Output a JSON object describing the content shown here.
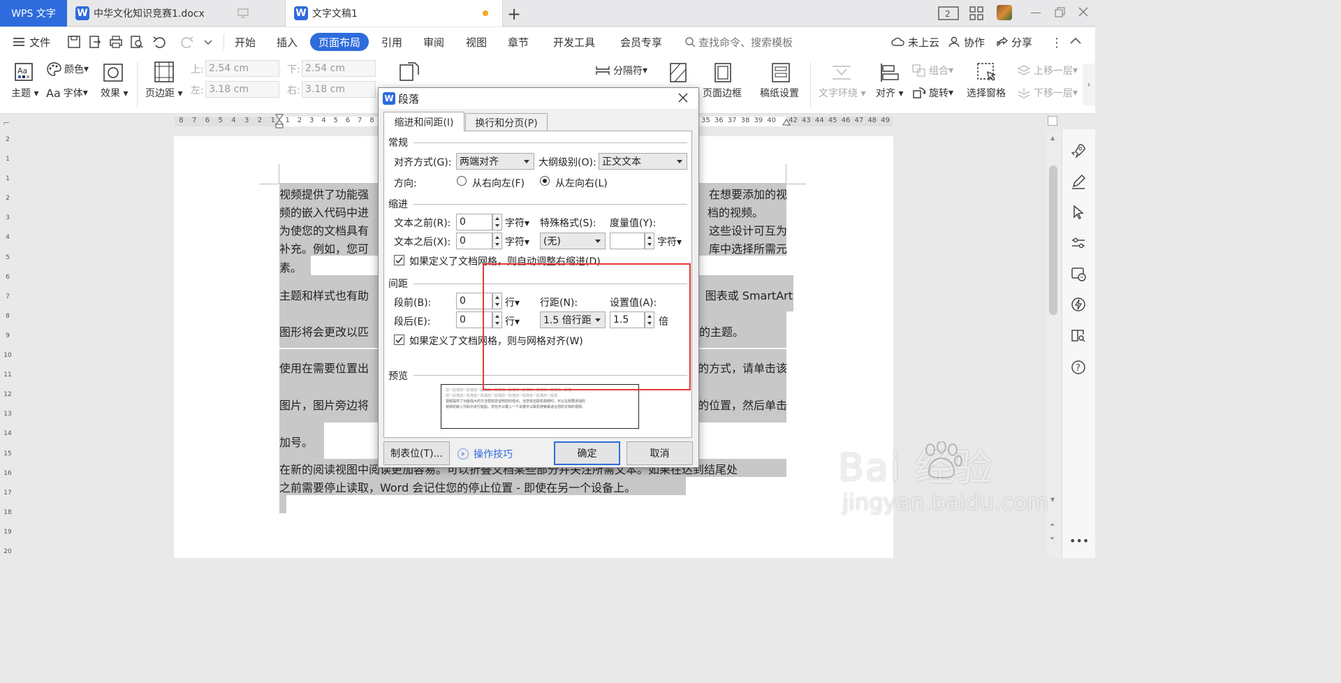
{
  "tabs": {
    "app": "WPS 文字",
    "doc1": "中华文化知识竞赛1.docx",
    "doc2": "文字文稿1"
  },
  "menubar": {
    "file": "文件",
    "items": [
      "开始",
      "插入",
      "页面布局",
      "引用",
      "审阅",
      "视图",
      "章节",
      "开发工具",
      "会员专享"
    ],
    "active": "页面布局",
    "search": "查找命令、搜索模板",
    "cloud": "未上云",
    "collab": "协作",
    "share": "分享"
  },
  "ribbon": {
    "theme": "主题",
    "colors": "颜色",
    "font": "字体",
    "effects": "效果",
    "margins": "页边距",
    "top_label": "上:",
    "top_value": "2.54 cm",
    "bottom_label": "下:",
    "bottom_value": "2.54 cm",
    "left_label": "左:",
    "left_value": "3.18 cm",
    "right_label": "右:",
    "right_value": "3.18 cm",
    "separator": "分隔符",
    "page_border": "页面边框",
    "grid_paper": "稿纸设置",
    "wrap": "文字环绕",
    "align": "对齐",
    "group": "组合",
    "rotate": "旋转",
    "select_pane": "选择窗格",
    "bring_forward": "上移一层",
    "send_backward": "下移一层"
  },
  "ruler": {
    "left_numbers": [
      "8",
      "7",
      "6",
      "5",
      "4",
      "3",
      "2",
      "1"
    ],
    "mid_numbers": [
      "1",
      "2",
      "3",
      "4",
      "5",
      "6",
      "7",
      "8"
    ],
    "right_numbers": [
      "35",
      "36",
      "37",
      "38",
      "39",
      "40",
      "42",
      "43",
      "44",
      "45",
      "46",
      "47",
      "48",
      "49"
    ],
    "v_numbers": [
      "2",
      "1",
      "1",
      "2",
      "3",
      "4",
      "5",
      "6",
      "7",
      "8",
      "9",
      "10",
      "11",
      "12",
      "13",
      "14",
      "15",
      "16",
      "17",
      "18",
      "19",
      "20"
    ]
  },
  "document": {
    "lines_left": [
      "视频提供了功能强",
      "频的嵌入代码中进",
      "为使您的文档具有",
      "补充。例如，您可",
      "素。",
      "主题和样式也有助",
      "图形将会更改以匹",
      "使用在需要位置出",
      "图片，图片旁边将",
      "加号。"
    ],
    "lines_right": [
      "在想要添加的视",
      "档的视频。",
      "这些设计可互为",
      "库中选择所需元",
      "",
      "图表或 SmartArt",
      "的主题。",
      "的方式，请单击该",
      "的位置，然后单击",
      ""
    ],
    "last_line1": "在新的阅读视图中阅读更加容易。可以折叠文档某些部分并关注所需文本。如果在达到结尾处",
    "last_line2": "之前需要停止读取，Word 会记住您的停止位置 - 即使在另一个设备上。"
  },
  "dialog": {
    "title": "段落",
    "tab_active": "缩进和间距(I)",
    "tab_other": "换行和分页(P)",
    "general": "常规",
    "align_label": "对齐方式(G):",
    "align_value": "两端对齐",
    "outline_label": "大纲级别(O):",
    "outline_value": "正文文本",
    "direction_label": "方向:",
    "rtl": "从右向左(F)",
    "ltr": "从左向右(L)",
    "indent": "缩进",
    "before_text_label": "文本之前(R):",
    "before_text_value": "0",
    "after_text_label": "文本之后(X):",
    "after_text_value": "0",
    "unit_char": "字符",
    "special_label": "特殊格式(S):",
    "special_value": "(无)",
    "measure_label": "度量值(Y):",
    "measure_value": "",
    "auto_indent": "如果定义了文档网格，则自动调整右缩进(D)",
    "spacing": "间距",
    "before_label": "段前(B):",
    "before_value": "0",
    "after_label": "段后(E):",
    "after_value": "0",
    "unit_line": "行",
    "line_spacing_label": "行距(N):",
    "line_spacing_value": "1.5 倍行距",
    "set_value_label": "设置值(A):",
    "set_value": "1.5",
    "unit_times": "倍",
    "snap_grid": "如果定义了文档网格，则与网格对齐(W)",
    "preview": "预览",
    "preview_line1": "前一段落前一段落前一段落前一段落前一段落前一段落前一段落前一段落前一段落",
    "preview_line2": "前一段落前一段落前一段落前一段落前一段落前一段落前一段落前一段落",
    "preview_line3": "视频提供了功能强大的方法帮助您证明您的观点。当您单击联机视频时，可以在想要添加的",
    "preview_line4": "视频的嵌入代码中进行粘贴。您也可以键入一个关键字以联机搜索最适合您的文档的视频。",
    "tabs_button": "制表位(T)...",
    "tips": "操作技巧",
    "ok": "确定",
    "cancel": "取消"
  },
  "watermark": {
    "brand": "Bai  经验",
    "url": "jingyan.baidu.com"
  },
  "colors": {
    "accent": "#2e6bdc",
    "highlight_box": "#e53935",
    "selection": "#c8c8c8"
  }
}
